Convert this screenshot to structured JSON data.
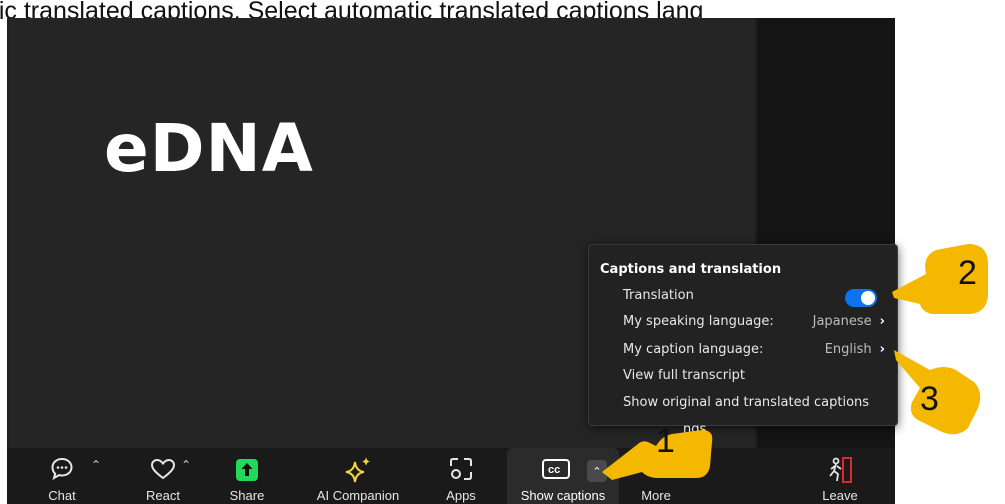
{
  "header_caption": "atic translated captions. Select automatic translated captions lang",
  "shared_content": {
    "title": "eDNA"
  },
  "captions_menu": {
    "title": "Captions and translation",
    "translation": {
      "label": "Translation",
      "enabled": true
    },
    "speaking_language": {
      "label": "My speaking language:",
      "value": "Japanese"
    },
    "caption_language": {
      "label": "My caption language:",
      "value": "English"
    },
    "view_transcript": "View full transcript",
    "show_original": "Show original and translated captions",
    "settings_partial": "ngs"
  },
  "toolbar": {
    "chat": "Chat",
    "react": "React",
    "share": "Share",
    "ai_companion": "AI Companion",
    "apps": "Apps",
    "show_captions": "Show captions",
    "more": "More",
    "leave": "Leave",
    "cc_icon_text": "cc"
  },
  "callouts": [
    "1",
    "2",
    "3"
  ],
  "colors": {
    "accent_blue": "#0e72ed",
    "share_green": "#23d959",
    "ai_yellow": "#f5d53b",
    "leave_red": "#e02828",
    "callout_yellow": "#f5b800"
  }
}
